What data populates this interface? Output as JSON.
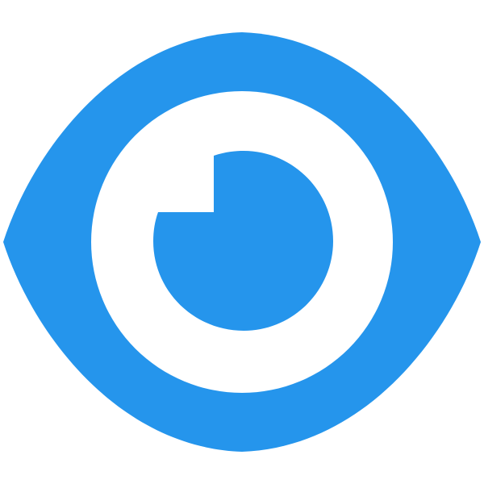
{
  "icon": {
    "name": "eye-icon",
    "colors": {
      "primary": "#2595EC",
      "background": "#FFFFFF"
    }
  }
}
